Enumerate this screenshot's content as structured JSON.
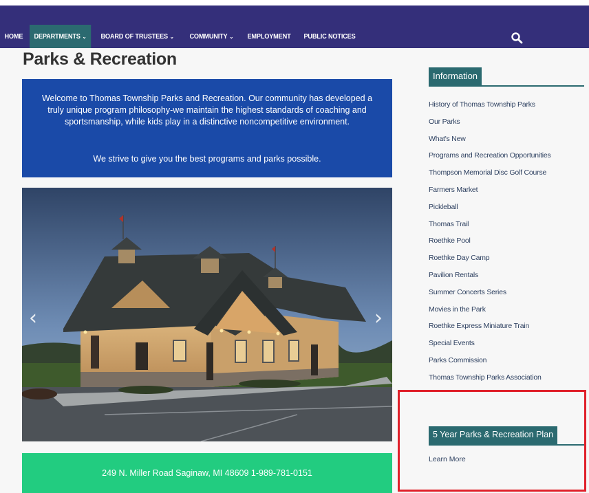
{
  "nav": {
    "items": [
      {
        "label": "HOME",
        "dropdown": false,
        "active": false
      },
      {
        "label": "DEPARTMENTS",
        "dropdown": true,
        "active": true
      },
      {
        "label": "BOARD OF TRUSTEES",
        "dropdown": true,
        "active": false
      },
      {
        "label": "COMMUNITY",
        "dropdown": true,
        "active": false
      },
      {
        "label": "EMPLOYMENT",
        "dropdown": false,
        "active": false
      },
      {
        "label": "PUBLIC NOTICES",
        "dropdown": false,
        "active": false
      }
    ],
    "search_icon": "search-icon",
    "bar_color": "#342f7a",
    "active_color": "#2b6a70"
  },
  "page": {
    "title": "Parks & Recreation"
  },
  "welcome": {
    "paragraph1": "Welcome to Thomas Township Parks and Recreation. Our community has developed a truly unique program philosophy-we maintain the highest standards of coaching and sportsmanship, while kids play in a distinctive noncompetitive environment.",
    "paragraph2": "We strive to give you the best programs and parks possible.",
    "color": "#1a4aa8"
  },
  "slider": {
    "prev_icon": "chevron-left-icon",
    "next_icon": "chevron-right-icon",
    "prev_glyph": "‹",
    "next_glyph": "›"
  },
  "address": {
    "text": "249 N. Miller Road Saginaw, MI 48609 1-989-781-0151",
    "color": "#22cc80"
  },
  "sidebar": {
    "info_heading": "Information",
    "links": [
      "History of Thomas Township Parks",
      "Our Parks",
      "What's New",
      "Programs and Recreation Opportunities",
      "Thompson Memorial Disc Golf Course",
      "Farmers Market",
      "Pickleball",
      "Thomas Trail",
      "Roethke Pool",
      "Roethke Day Camp",
      "Pavilion Rentals",
      "Summer Concerts Series",
      "Movies in the Park",
      "Roethke Express Miniature Train",
      "Special Events",
      "Parks Commission",
      "Thomas Township Parks Association"
    ],
    "plan_heading": "5 Year Parks & Recreation Plan",
    "learn_more": "Learn More",
    "highlight_color": "#e0202a"
  }
}
